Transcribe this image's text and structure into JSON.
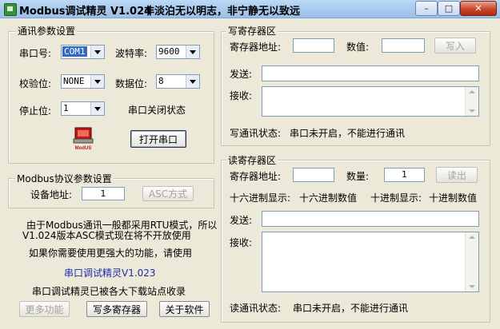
{
  "window": {
    "title": "Modbus调试精灵 V1.024",
    "motto": "非淡泊无以明志，非宁静无以致远",
    "minimize": "–",
    "maximize": "□",
    "close": "✕"
  },
  "comm": {
    "group_title": "通讯参数设置",
    "port_label": "串口号:",
    "port_value": "COM1",
    "baud_label": "波特率:",
    "baud_value": "9600",
    "parity_label": "校验位:",
    "parity_value": "NONE",
    "databits_label": "数据位:",
    "databits_value": "8",
    "stopbits_label": "停止位:",
    "stopbits_value": "1",
    "port_status": "串口关闭状态",
    "icon_caption": "ModUS",
    "open_port_button": "打开串口"
  },
  "protocol": {
    "group_title": "Modbus协议参数设置",
    "device_addr_label": "设备地址:",
    "device_addr_value": "1",
    "asc_button": "ASC方式"
  },
  "info": {
    "line1": "由于Modbus通讯一般都采用RTU模式，所以",
    "line2": "V1.024版本ASC模式现在将不开放使用",
    "line3": "如果你需要使用更强大的功能，请使用",
    "line4": "串口调试精灵V1.023",
    "line5": "串口调试精灵已被各大下载站点收录"
  },
  "bottom_buttons": {
    "more": "更多功能",
    "write_multi": "写多寄存器",
    "about": "关于软件"
  },
  "write": {
    "group_title": "写寄存器区",
    "reg_addr_label": "寄存器地址:",
    "reg_addr_value": "",
    "value_label": "数值:",
    "value_value": "",
    "write_button": "写入",
    "send_label": "发送:",
    "recv_label": "接收:",
    "status_label": "写通讯状态:",
    "status_value": "串口未开启，不能进行通讯"
  },
  "read": {
    "group_title": "读寄存器区",
    "reg_addr_label": "寄存器地址:",
    "reg_addr_value": "",
    "qty_label": "数量:",
    "qty_value": "1",
    "read_button": "读出",
    "hex_label": "十六进制显示:",
    "hex_value": "十六进制数值",
    "dec_label": "十进制显示:",
    "dec_value": "十进制数值",
    "send_label": "发送:",
    "recv_label": "接收:",
    "status_label": "读通讯状态:",
    "status_value": "串口未开启，不能进行通讯"
  }
}
